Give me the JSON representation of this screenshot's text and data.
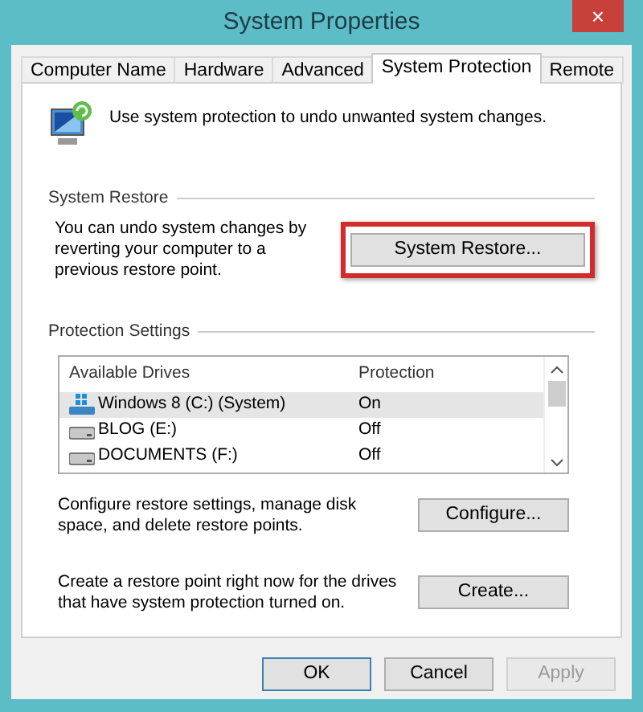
{
  "window": {
    "title": "System Properties",
    "close": "×"
  },
  "tabs": [
    {
      "label": "Computer Name",
      "selected": false
    },
    {
      "label": "Hardware",
      "selected": false
    },
    {
      "label": "Advanced",
      "selected": false
    },
    {
      "label": "System Protection",
      "selected": true
    },
    {
      "label": "Remote",
      "selected": false
    }
  ],
  "intro": "Use system protection to undo unwanted system changes.",
  "system_restore": {
    "title": "System Restore",
    "text": "You can undo system changes by reverting your computer to a previous restore point.",
    "button": {
      "label": "System Restore...",
      "highlighted": true
    }
  },
  "protection_settings": {
    "title": "Protection Settings",
    "columns": [
      "Available Drives",
      "Protection"
    ],
    "drives": [
      {
        "name": "Windows 8 (C:) (System)",
        "protection": "On",
        "kind": "system",
        "selected": true
      },
      {
        "name": "BLOG (E:)",
        "protection": "Off",
        "kind": "disk",
        "selected": false
      },
      {
        "name": "DOCUMENTS (F:)",
        "protection": "Off",
        "kind": "disk",
        "selected": false
      }
    ],
    "actions": [
      {
        "text": "Configure restore settings, manage disk space, and delete restore points.",
        "button": "Configure..."
      },
      {
        "text": "Create a restore point right now for the drives that have system protection turned on.",
        "button": "Create..."
      }
    ]
  },
  "buttons": [
    {
      "label": "OK",
      "default": true,
      "disabled": false
    },
    {
      "label": "Cancel",
      "default": false,
      "disabled": false
    },
    {
      "label": "Apply",
      "default": false,
      "disabled": true
    }
  ]
}
